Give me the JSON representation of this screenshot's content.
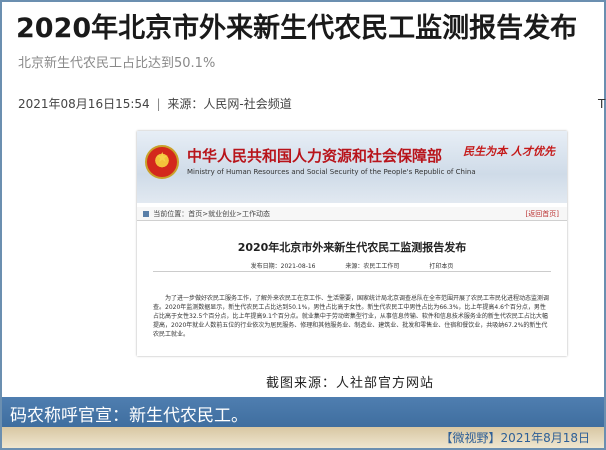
{
  "article": {
    "headline": "2020年北京市外来新生代农民工监测报告发布",
    "subheadline": "北京新生代农民工占比达到50.1%",
    "date": "2021年08月16日15:54",
    "separator": "|",
    "source": "来源：人民网-社会频道",
    "edge_char": "T"
  },
  "embedded_screenshot": {
    "org_cn": "中华人民共和国人力资源和社会保障部",
    "org_en": "Ministry of Human Resources and Social Security of the People's Republic of China",
    "slogan": "民生为本 人才优先",
    "breadcrumb": "当前位置：首页>就业创业>工作动态",
    "return_link": "[返回首页]",
    "doc_title": "2020年北京市外来新生代农民工监测报告发布",
    "doc_date": "发布日期：2021-08-16",
    "doc_source": "来源：农民工工作司",
    "doc_print": "打印本页",
    "doc_body": "为了进一步做好农民工服务工作，了解外来农民工在京工作、生活需要，国家统计局北京调查总队在全市范围开展了农民工市民化进程动态监测调查。2020年监测数据显示，新生代农民工占比达到50.1%，男性占比高于女性。新生代农民工中男性占比为66.3%，比上年提高4.6个百分点，男性占比高于女性32.5个百分点，比上年提高9.1个百分点。就业集中于劳动密集型行业，从事信息传输、软件和信息技术服务业的新生代农民工占比大幅提高，2020年就业人数前五位的行业依次为居民服务、修理和其他服务业、制造业、建筑业、批发和零售业、住宿和餐饮业，共吸纳67.2%的新生代农民工就业。"
  },
  "credit": "截图来源：人社部官方网站",
  "caption": "码农称呼官宣：新生代农民工。",
  "footer": "【微视野】2021年8月18日",
  "colors": {
    "caption_bar": "#4f7eb0",
    "footer_text": "#2d5f97",
    "banner_red": "#b8141b"
  }
}
